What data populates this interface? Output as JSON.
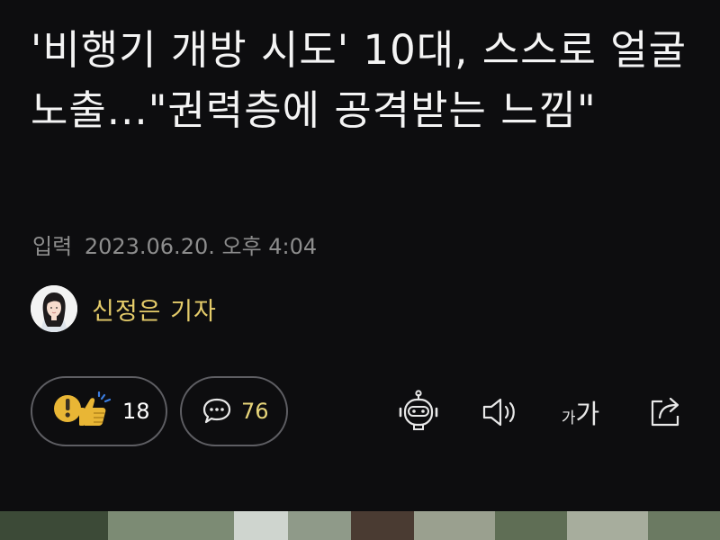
{
  "article": {
    "headline": "'비행기 개방 시도' 10대, 스스로 얼굴 노출...\"권력층에 공격받는 느낌\"",
    "date_label": "입력",
    "date_value": "2023.06.20. 오후 4:04"
  },
  "reporter": {
    "name": "신정은 기자"
  },
  "reactions": {
    "like_count": "18",
    "comment_count": "76"
  },
  "toolbar": {
    "font_small": "가",
    "font_big": "가",
    "icons": [
      "robot-summary-icon",
      "speaker-icon",
      "font-size-icon",
      "share-icon"
    ]
  },
  "colors": {
    "background": "#0d0d0f",
    "headline": "#f4f4f4",
    "dateline": "#8d8d8d",
    "reporter": "#e5cc6a",
    "comment_count": "#e7d57a",
    "pill_border": "#5e5e63",
    "like_icon": "#e9b635",
    "like_accent": "#3b7de0"
  }
}
